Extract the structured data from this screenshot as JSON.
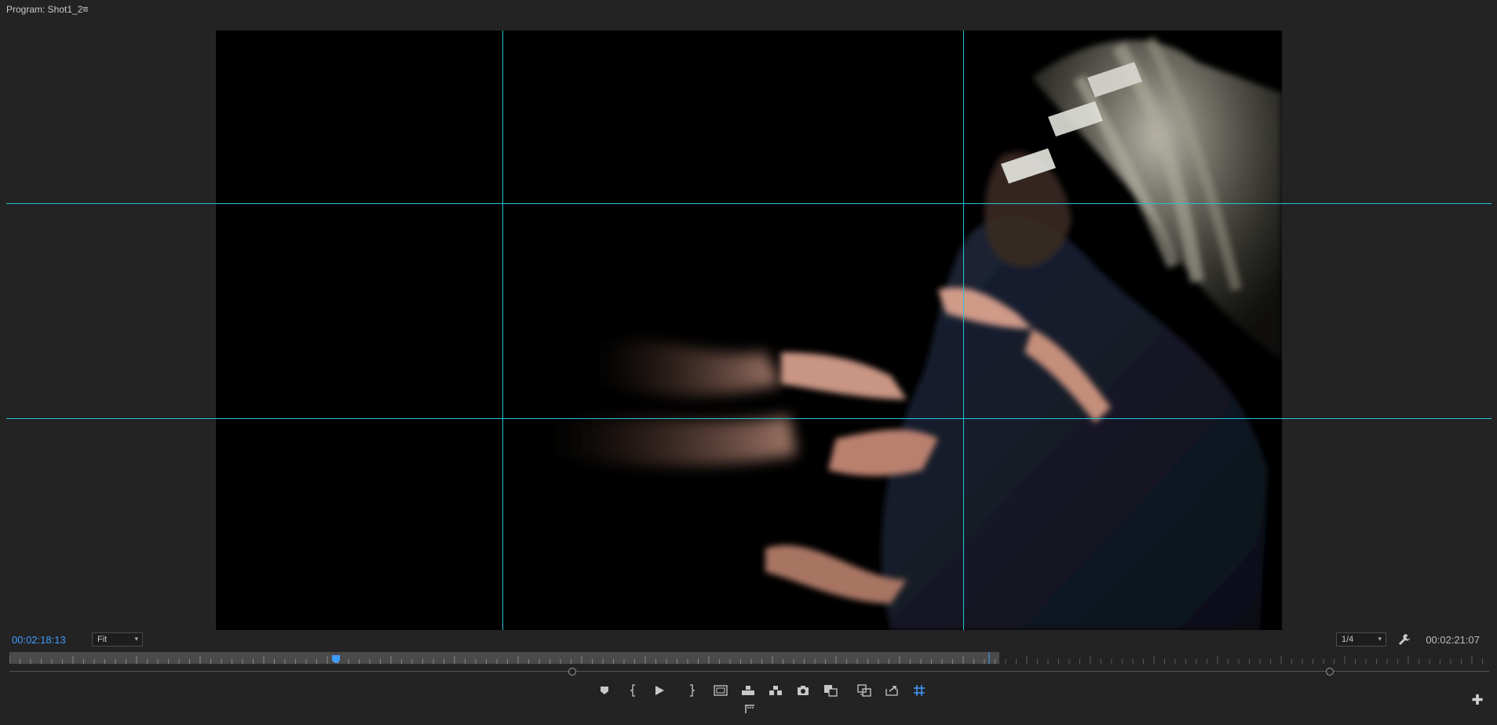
{
  "panel": {
    "title": "Program: Shot1_2",
    "menu_icon": "hamburger-menu-icon"
  },
  "timecode": {
    "current": "00:02:18:13",
    "duration": "00:02:21:07"
  },
  "zoom": {
    "selected": "Fit"
  },
  "resolution": {
    "selected": "1/4"
  },
  "settings_icon": "wrench-icon",
  "playhead_icon": "playhead-icon",
  "controls": [
    {
      "name": "add-marker-button",
      "icon": "marker-icon"
    },
    {
      "name": "mark-in-button",
      "icon": "mark-in-icon"
    },
    {
      "name": "play-button",
      "icon": "play-icon"
    },
    {
      "name": "mark-out-button",
      "icon": "mark-out-icon"
    },
    {
      "name": "safe-margins-button",
      "icon": "safe-margins-icon"
    },
    {
      "name": "lift-button",
      "icon": "lift-icon"
    },
    {
      "name": "extract-button",
      "icon": "extract-icon"
    },
    {
      "name": "export-frame-button",
      "icon": "camera-icon"
    },
    {
      "name": "comparison-view-button",
      "icon": "comparison-icon"
    },
    {
      "name": "toggle-proxies-button",
      "icon": "proxy-icon"
    },
    {
      "name": "export-button",
      "icon": "export-icon"
    },
    {
      "name": "guides-button",
      "icon": "grid-icon"
    },
    {
      "name": "vr-video-button",
      "icon": "vr-icon"
    }
  ],
  "add_button_icon": "plus-icon",
  "colors": {
    "accent": "#3f9bff",
    "guide": "#27c3d6",
    "background": "#232323"
  }
}
